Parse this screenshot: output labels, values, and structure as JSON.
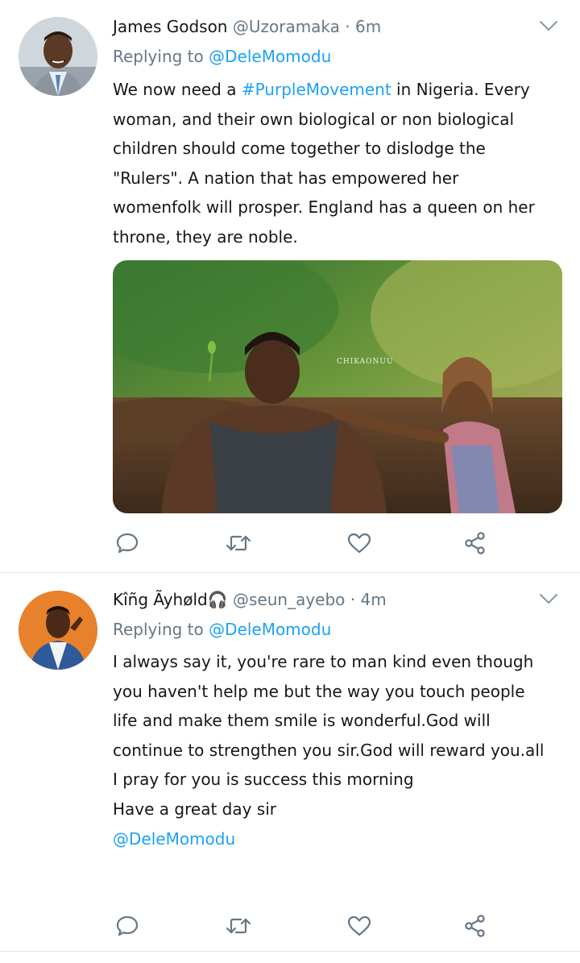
{
  "colors": {
    "link": "#1da1f2",
    "secondary_text": "#657786",
    "primary_text": "#14171a",
    "divider": "#e1e8ed"
  },
  "tweets": [
    {
      "author_name": "James Godson",
      "handle": "@Uzoramaka",
      "dot": "·",
      "time": "6m",
      "replying_prefix": "Replying to",
      "replying_to": "@DeleMomodu",
      "text_before_hashtag": "We now need a ",
      "hashtag": "#PurpleMovement",
      "text_after_hashtag": " in Nigeria. Every woman, and their own biological or non biological children should come together to dislodge the \"Rulers\". A nation that has empowered her womenfolk will prosper. England has a queen on her throne, they are noble.",
      "media_watermark": "CHIKAONUU",
      "avatar_icon": "user-avatar-photo",
      "actions": [
        "reply-icon",
        "retweet-icon",
        "like-icon",
        "share-icon"
      ]
    },
    {
      "author_name": "Kîñg Ãyhøld🎧",
      "handle": "@seun_ayebo",
      "dot": "·",
      "time": "4m",
      "replying_prefix": "Replying to",
      "replying_to": "@DeleMomodu",
      "text": "I always say it, you're rare to man kind even though you haven't help me but the way you touch people life and make them smile is wonderful.God will continue to strengthen you sir.God will reward you.all I pray for you is success this morning",
      "text_line2": "Have a great day sir",
      "trailing_mention": "@DeleMomodu",
      "avatar_icon": "user-avatar-photo",
      "actions": [
        "reply-icon",
        "retweet-icon",
        "like-icon",
        "share-icon"
      ]
    }
  ]
}
